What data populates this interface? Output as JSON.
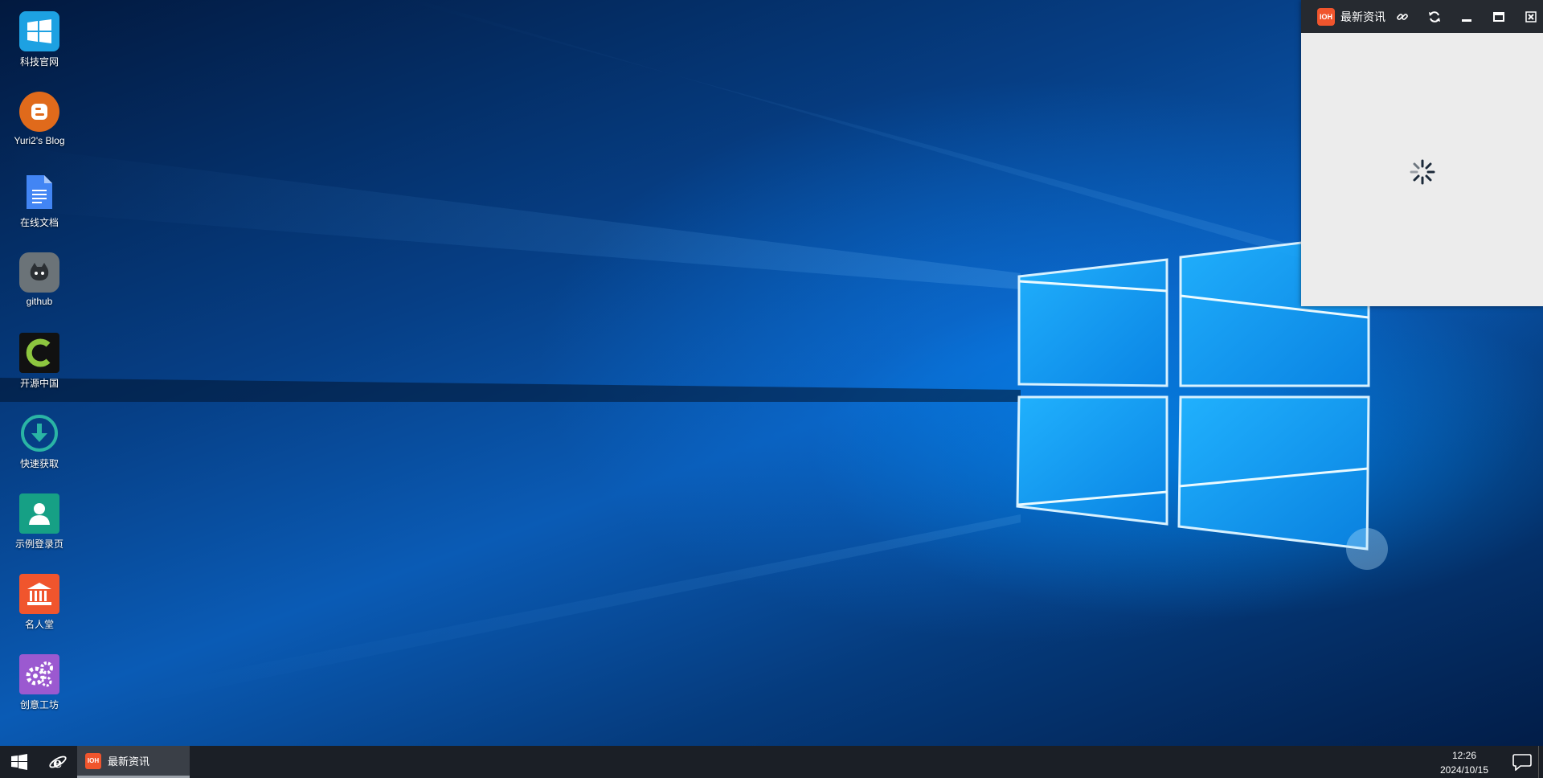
{
  "desktop": {
    "icons": [
      {
        "label": "科技官网",
        "icon": "windows-logo-icon",
        "color": "#1da1e2"
      },
      {
        "label": "Yuri2's Blog",
        "icon": "blogger-icon",
        "color": "#e06a1b"
      },
      {
        "label": "在线文档",
        "icon": "document-icon",
        "color": "#4285f4"
      },
      {
        "label": "github",
        "icon": "github-icon",
        "color": "#6b7378"
      },
      {
        "label": "开源中国",
        "icon": "oschina-icon",
        "color": "#8dc63f"
      },
      {
        "label": "快速获取",
        "icon": "download-icon",
        "color": "#2ab5a5"
      },
      {
        "label": "示例登录页",
        "icon": "user-icon",
        "color": "#16a085"
      },
      {
        "label": "名人堂",
        "icon": "museum-icon",
        "color": "#f0552d"
      },
      {
        "label": "创意工坊",
        "icon": "gears-icon",
        "color": "#9b59d0"
      }
    ]
  },
  "window": {
    "title": "最新资讯",
    "app_icon_text": "IOH",
    "buttons": {
      "link": "link-icon",
      "refresh": "refresh-icon",
      "minimize": "minimize-icon",
      "maximize": "maximize-icon",
      "close": "close-icon"
    },
    "background": "#ececec",
    "loading": true
  },
  "taskbar": {
    "items": [
      {
        "label": "最新资讯",
        "app_icon_text": "IOH"
      }
    ],
    "time": "12:26",
    "date": "2024/10/15"
  }
}
